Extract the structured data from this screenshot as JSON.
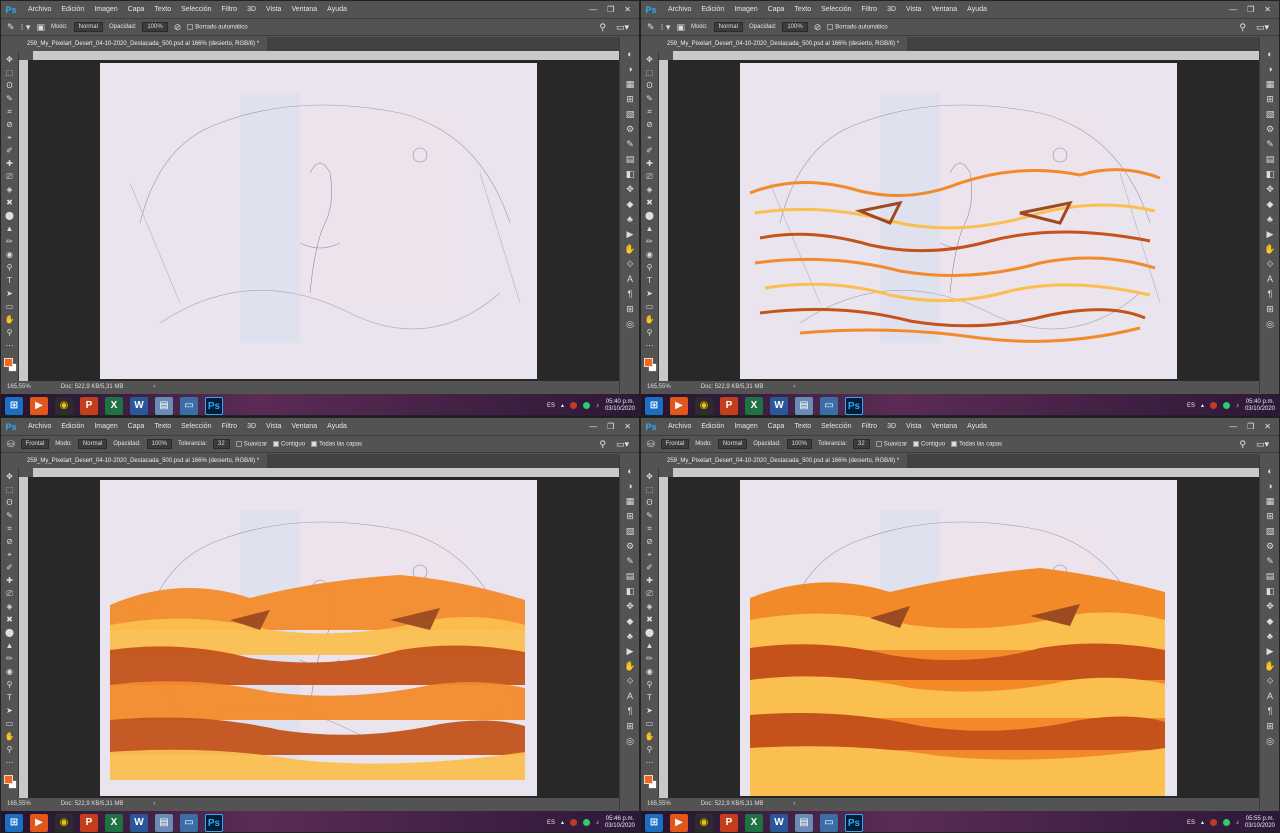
{
  "menu": [
    "Archivo",
    "Edición",
    "Imagen",
    "Capa",
    "Texto",
    "Selección",
    "Filtro",
    "3D",
    "Vista",
    "Ventana",
    "Ayuda"
  ],
  "app_logo": "Ps",
  "window_controls": [
    "—",
    "❐",
    "✕"
  ],
  "brush_options": {
    "mode_label": "Modo:",
    "mode_value": "Normal",
    "opacity_label": "Opacidad:",
    "opacity_value": "100%",
    "auto_erase_label": "Borrado automático"
  },
  "bucket_options": {
    "preset": "Frontal",
    "mode_label": "Modo:",
    "mode_value": "Normal",
    "opacity_label": "Opacidad:",
    "opacity_value": "100%",
    "tolerance_label": "Tolerancia:",
    "tolerance_value": "32",
    "smooth_label": "Suavizar",
    "contiguous_label": "Contiguo",
    "all_layers_label": "Todas las capas"
  },
  "document_tab": "259_My_Pixelart_Desert_04-10-2020_Destacada_500.psd al 166% (desierto, RGB/8) *",
  "status": {
    "zoom": "165,55%",
    "doc": "Doc: 522,9 KB/5,31 MB"
  },
  "taskbar": {
    "lang": "ES",
    "date": "03/10/2020"
  },
  "windows": [
    {
      "time": "05:40 p.m."
    },
    {
      "time": "05:40 p.m."
    },
    {
      "time": "05:46 p.m."
    },
    {
      "time": "05:55 p.m."
    }
  ],
  "colors": {
    "foreground_swatch": "#f06a1b",
    "accent_blue": "#31a8ff",
    "dune_dark": "#c4521a",
    "dune_mid": "#f38a2a",
    "dune_light": "#fbbf50",
    "dune_brown": "#9c4a22",
    "paper": "#ebe6ef"
  }
}
